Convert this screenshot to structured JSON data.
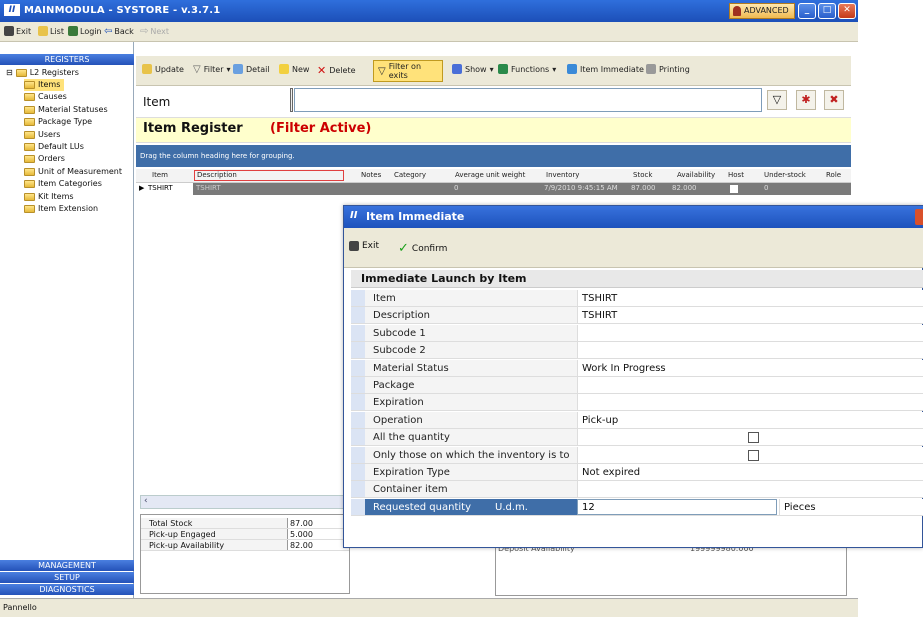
{
  "window": {
    "title": "MAINMODULA - SYSTORE - v.3.7.1",
    "logo": "II",
    "badge": "ADVANCED"
  },
  "toolbar_top": {
    "exit": "Exit",
    "list": "List",
    "login": "Login",
    "back": "Back",
    "next": "Next"
  },
  "nav": {
    "registers": "REGISTERS",
    "root": "L2 Registers",
    "items": [
      "Items",
      "Causes",
      "Material Statuses",
      "Package Type",
      "Users",
      "Default LUs",
      "Orders",
      "Unit of Measurement",
      "Item Categories",
      "Kit Items",
      "Item Extension"
    ],
    "management": "MANAGEMENT",
    "setup": "SETUP",
    "diagnostics": "DIAGNOSTICS"
  },
  "toolbar_main": {
    "update": "Update",
    "filter": "Filter",
    "detail": "Detail",
    "new": "New",
    "delete": "Delete",
    "filter_exits": "Filter on exits",
    "show": "Show",
    "functions": "Functions",
    "item_immediate": "Item Immediate",
    "printing": "Printing"
  },
  "search": {
    "label": "Item",
    "value": ""
  },
  "register": {
    "title": "Item Register",
    "filter": "(Filter Active)"
  },
  "grid": {
    "group_hint": "Drag the column heading here for grouping.",
    "columns": [
      "Item",
      "Description",
      "Notes",
      "Category",
      "Average unit weight",
      "Inventory",
      "Stock",
      "Availability",
      "Host",
      "Under-stock",
      "Role"
    ],
    "row": {
      "item": "TSHIRT",
      "description": "TSHIRT",
      "weight": "0",
      "inventory": "7/9/2010 9:45:15 AM",
      "stock": "87.000",
      "availability": "82.000",
      "understock": "0"
    }
  },
  "totals": [
    {
      "label": "Total Stock",
      "value": "87.00"
    },
    {
      "label": "Pick-up Engaged",
      "value": "5.000"
    },
    {
      "label": "Pick-up Availability",
      "value": "82.00"
    }
  ],
  "deposit": {
    "label": "Deposit Availability",
    "value": "199999980.000"
  },
  "statusbar": "Pannello",
  "dialog": {
    "title": "Item Immediate",
    "exit": "Exit",
    "confirm": "Confirm",
    "section": "Immediate Launch by Item",
    "rows": [
      {
        "label": "Item",
        "value": "TSHIRT"
      },
      {
        "label": "Description",
        "value": "TSHIRT"
      },
      {
        "label": "Subcode 1",
        "value": ""
      },
      {
        "label": "Subcode 2",
        "value": ""
      },
      {
        "label": "Material Status",
        "value": "Work In Progress"
      },
      {
        "label": "Package",
        "value": ""
      },
      {
        "label": "Expiration",
        "value": ""
      },
      {
        "label": "Operation",
        "value": "Pick-up"
      },
      {
        "label": "All the quantity",
        "value": ""
      },
      {
        "label": "Only those on which the inventory is to",
        "value": ""
      },
      {
        "label": "Expiration Type",
        "value": "Not expired"
      },
      {
        "label": "Container item",
        "value": ""
      }
    ],
    "requested": {
      "label": "Requested quantity",
      "udm": "U.d.m.",
      "value": "12",
      "unit": "Pieces"
    }
  },
  "colors": {
    "titlebar": "#1c4fb8",
    "filter_active": "#cc0000",
    "grid_header": "#3f6ea8",
    "highlight": "#ffe27a"
  }
}
